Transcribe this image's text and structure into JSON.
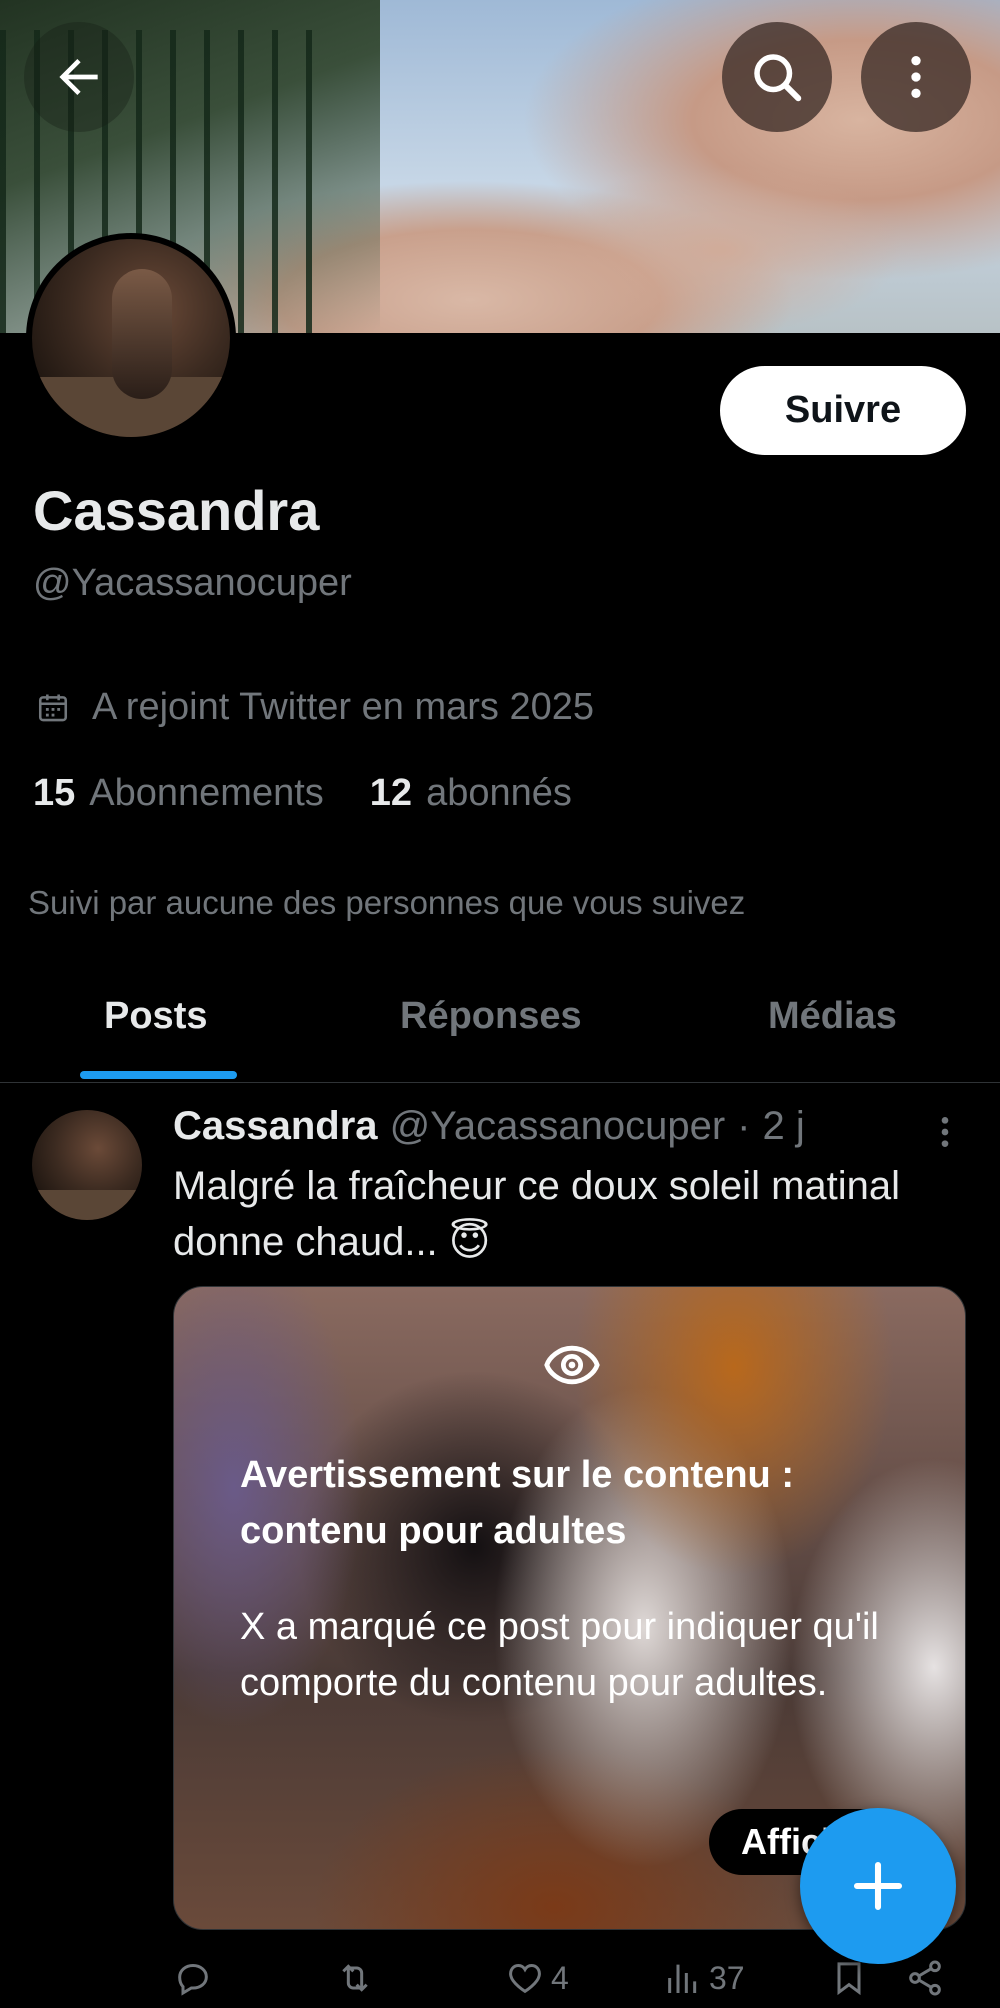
{
  "profile": {
    "name": "Cassandra",
    "handle": "@Yacassanocuper",
    "follow_label": "Suivre",
    "joined": "A rejoint Twitter en mars 2025",
    "following_count": "15",
    "following_label": "Abonnements",
    "followers_count": "12",
    "followers_label": "abonnés",
    "followed_by": "Suivi par aucune des personnes que vous suivez"
  },
  "header": {
    "back_icon": "arrow-left-icon",
    "search_icon": "search-icon",
    "more_icon": "more-vertical-icon"
  },
  "tabs": [
    {
      "label": "Posts",
      "active": true
    },
    {
      "label": "Réponses",
      "active": false
    },
    {
      "label": "Médias",
      "active": false
    }
  ],
  "post": {
    "name": "Cassandra",
    "handle": "@Yacassanocuper",
    "separator": "·",
    "time": "2 j",
    "text": "Malgré la fraîcheur ce doux soleil matinal donne chaud... 😇",
    "warning_title": "Avertissement sur le contenu : contenu pour adultes",
    "warning_body": "X a marqué ce post pour indiquer qu'il comporte du contenu pour adultes.",
    "show_label": "Afficher",
    "likes": "4",
    "views": "37"
  },
  "colors": {
    "accent": "#1d9bf0",
    "text_primary": "#e7e9ea",
    "text_secondary": "#71767b",
    "background": "#000000"
  }
}
